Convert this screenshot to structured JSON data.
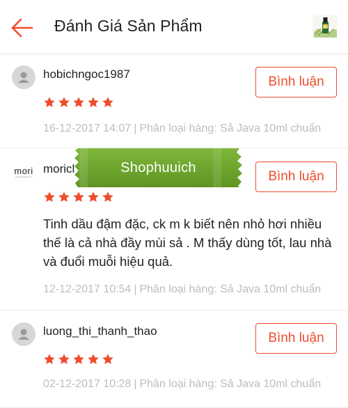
{
  "header": {
    "title": "Đánh Giá Sản Phẩm",
    "back_icon": "arrow-left-icon",
    "thumbnail_icon": "product-thumbnail"
  },
  "colors": {
    "accent": "#ee4d2d",
    "star": "#ee4d2d",
    "meta_text": "#bdbdbd",
    "watermark_green": "#6fa52a"
  },
  "reviews": [
    {
      "username": "hobichngoc1987",
      "avatar": "default-user-avatar",
      "rating": 5,
      "text": "",
      "date": "16-12-2017 14:07",
      "separator": "|",
      "variation": "Phân loại hàng: Sả Java 10ml chuẩn",
      "button": "Bình luận"
    },
    {
      "username": "moricl",
      "avatar": "mori-logo",
      "avatar_text": "mori",
      "avatar_subtext": "www.moristore.vn",
      "rating": 5,
      "text": "Tinh dầu đậm đặc, ck m k biết nên nhỏ hơi nhiều thế là cả nhà đầy mùi sả . M thấy dùng tốt, lau nhà và đuổi muỗi hiệu quả.",
      "date": "12-12-2017 10:54",
      "separator": "|",
      "variation": "Phân loại hàng: Sả Java 10ml chuẩn",
      "button": "Bình luận"
    },
    {
      "username": "luong_thi_thanh_thao",
      "avatar": "default-user-avatar",
      "rating": 5,
      "text": "",
      "date": "02-12-2017 10:28",
      "separator": "|",
      "variation": "Phân loại hàng: Sả Java 10ml chuẩn",
      "button": "Bình luận"
    }
  ],
  "watermark": {
    "text": "Shophuuich"
  }
}
